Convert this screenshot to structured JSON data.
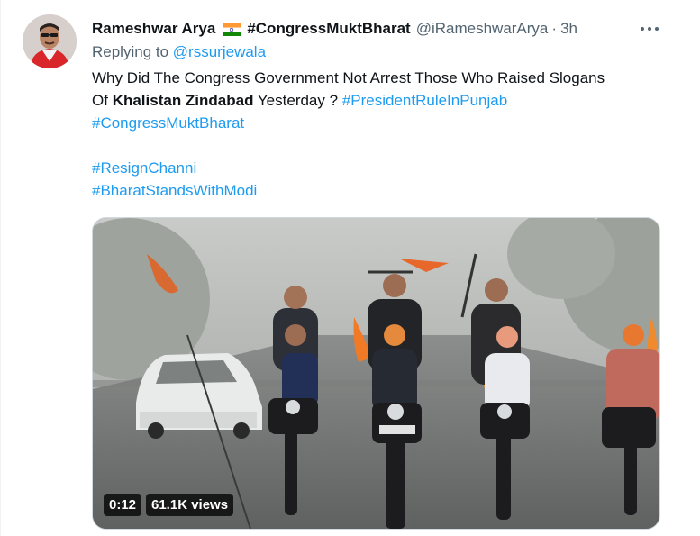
{
  "author": {
    "name": "Rameshwar Arya",
    "flag_icon": "india-flag-icon",
    "name_hashtag": "#CongressMuktBharat",
    "handle": "@iRameshwarArya",
    "separator": "·",
    "time": "3h"
  },
  "reply": {
    "prefix": "Replying to",
    "mention": "@rssurjewala"
  },
  "tweet": {
    "line1": "Why Did The Congress Government Not Arrest Those Who Raised Slogans",
    "line2_prefix": "Of",
    "line2_bold": "Khalistan Zindabad",
    "line2_suffix": "Yesterday ?",
    "hashtag1": "#PresidentRuleInPunjab",
    "hashtag2": "#CongressMuktBharat",
    "hashtag3": "#ResignChanni",
    "hashtag4": "#BharatStandsWithModi"
  },
  "video": {
    "duration": "0:12",
    "views": "61.1K views"
  },
  "colors": {
    "link": "#1d9bf0",
    "secondary_text": "#536471",
    "primary_text": "#0f1419"
  }
}
